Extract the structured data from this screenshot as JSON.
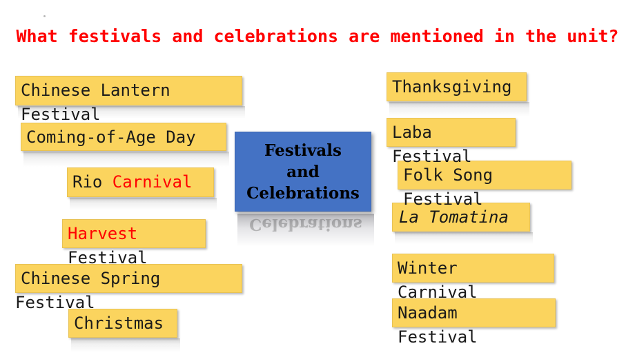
{
  "slide": {
    "title": "What festivals and celebrations are mentioned in the unit?",
    "title_color": "#FF0000",
    "background_color": "#FFFFFF"
  },
  "center_node": {
    "name": "festivals-and-celebrations",
    "fill_color": "#4472C4",
    "text_color": "#000000",
    "lines": [
      "Festivals",
      "and",
      "Celebrations"
    ],
    "reflection": true
  },
  "chip_style": {
    "fill_color": "#FBD45E",
    "text_color": "#1A1A1A",
    "highlight_color": "#FF0000"
  },
  "left_column": [
    {
      "name": "chinese-lantern-festival",
      "line1": "Chinese Lantern",
      "line2": "Festival",
      "line1_color": "black",
      "line2_color": "black",
      "italic": false
    },
    {
      "name": "coming-of-age-day",
      "line1": "Coming-of-Age Day",
      "line2": "",
      "line1_color": "black",
      "line2_color": "black",
      "italic": false
    },
    {
      "name": "rio-carnival",
      "line1": "Rio ",
      "line1_red": "Carnival",
      "line2": "",
      "line1_color": "mixed",
      "line2_color": "black",
      "italic": false
    },
    {
      "name": "harvest-festival",
      "line1": "Harvest",
      "line2": "Festival",
      "line1_color": "red",
      "line2_color": "black",
      "italic": false
    },
    {
      "name": "chinese-spring-festival",
      "line1": "Chinese Spring",
      "line2": "Festival",
      "line1_color": "black",
      "line2_color": "black",
      "italic": false
    },
    {
      "name": "christmas",
      "line1": "Christmas",
      "line2": "",
      "line1_color": "black",
      "line2_color": "black",
      "italic": false
    }
  ],
  "right_column": [
    {
      "name": "thanksgiving",
      "line1": "Thanksgiving",
      "line2": "",
      "line1_color": "black",
      "line2_color": "black",
      "italic": false
    },
    {
      "name": "laba-festival",
      "line1": "Laba",
      "line2": "Festival",
      "line1_color": "black",
      "line2_color": "black",
      "italic": false
    },
    {
      "name": "folk-song-festival",
      "line1": "Folk Song",
      "line2": "Festival",
      "line1_color": "black",
      "line2_color": "black",
      "italic": false
    },
    {
      "name": "la-tomatina",
      "line1": "La Tomatina",
      "line2": "",
      "line1_color": "black",
      "line2_color": "black",
      "italic": true
    },
    {
      "name": "winter-carnival",
      "line1": "Winter",
      "line2": "Carnival",
      "line1_color": "black",
      "line2_color": "black",
      "italic": false
    },
    {
      "name": "naadam-festival",
      "line1": "Naadam",
      "line2": "Festival",
      "line1_color": "black",
      "line2_color": "black",
      "italic": false
    }
  ]
}
